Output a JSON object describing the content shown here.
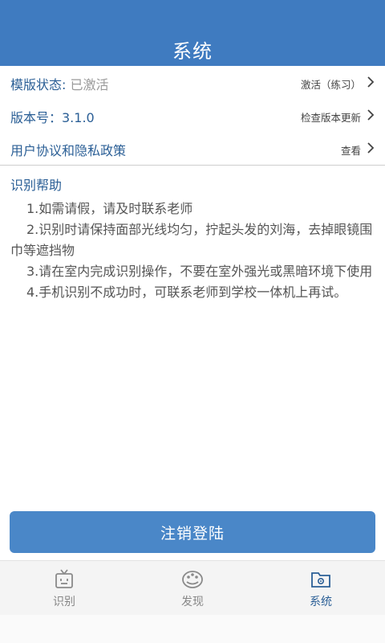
{
  "header": {
    "title": "系统"
  },
  "rows": [
    {
      "label": "模版状态:",
      "value": "已激活",
      "action": "激活（练习）"
    },
    {
      "label": "版本号：3.1.0",
      "value": "",
      "action": "检查版本更新"
    },
    {
      "label": "用户协议和隐私政策",
      "value": "",
      "action": "查看"
    }
  ],
  "help": {
    "title": "识别帮助",
    "items": [
      "1.如需请假，请及时联系老师",
      "2.识别时请保持面部光线均匀，拧起头发的刘海，去掉眼镜围巾等遮挡物",
      "3.请在室内完成识别操作，不要在室外强光或黑暗环境下使用",
      "4.手机识别不成功时，可联系老师到学校一体机上再试。"
    ]
  },
  "logout_button": {
    "label": "注销登陆"
  },
  "tabs": [
    {
      "label": "识别",
      "icon": "tv-icon",
      "active": false
    },
    {
      "label": "发现",
      "icon": "palette-icon",
      "active": false
    },
    {
      "label": "系统",
      "icon": "gear-folder-icon",
      "active": true
    }
  ],
  "colors": {
    "primary": "#3f7bc0",
    "button": "#4a87c8",
    "label": "#2b5f96"
  }
}
